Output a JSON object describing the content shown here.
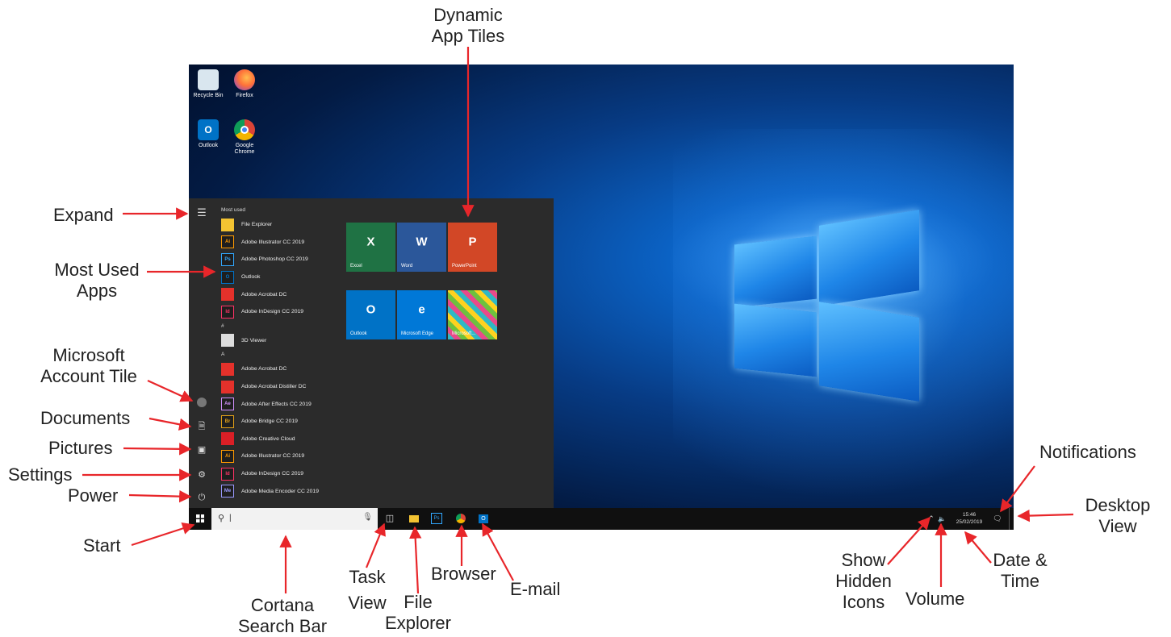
{
  "callouts": {
    "dynamic_tiles": [
      "Dynamic",
      "App Tiles"
    ],
    "expand": "Expand",
    "most_used_apps": [
      "Most Used",
      "Apps"
    ],
    "account_tile": [
      "Microsoft",
      "Account Tile"
    ],
    "documents": "Documents",
    "pictures": "Pictures",
    "settings": "Settings",
    "power": "Power",
    "start": "Start",
    "cortana": [
      "Cortana",
      "Search Bar"
    ],
    "task_view": [
      "Task",
      "View"
    ],
    "file_explorer": [
      "File",
      "Explorer"
    ],
    "browser": "Browser",
    "email": "E-mail",
    "notifications": "Notifications",
    "desktop_view": [
      "Desktop",
      "View"
    ],
    "show_hidden": [
      "Show",
      "Hidden",
      "Icons"
    ],
    "volume": "Volume",
    "date_time": [
      "Date &",
      "Time"
    ]
  },
  "desktop_icons": [
    {
      "label": "Recycle Bin",
      "icon": "recycle-bin-icon"
    },
    {
      "label": "Firefox",
      "icon": "firefox-icon"
    },
    {
      "label": "Outlook",
      "icon": "outlook-icon"
    },
    {
      "label": "Google Chrome",
      "icon": "chrome-icon"
    }
  ],
  "start_menu": {
    "most_used_header": "Most used",
    "most_used": [
      {
        "label": "File Explorer",
        "badge": "",
        "color": "#f3c332"
      },
      {
        "label": "Adobe Illustrator CC 2019",
        "badge": "Ai",
        "color": "#ff9a00"
      },
      {
        "label": "Adobe Photoshop CC 2019",
        "badge": "Ps",
        "color": "#31a8ff"
      },
      {
        "label": "Outlook",
        "badge": "O",
        "color": "#0072c6"
      },
      {
        "label": "Adobe Acrobat DC",
        "badge": "",
        "color": "#e4312b"
      },
      {
        "label": "Adobe InDesign CC 2019",
        "badge": "Id",
        "color": "#ff3366"
      }
    ],
    "section_hash": "#",
    "hash_apps": [
      {
        "label": "3D Viewer",
        "badge": "",
        "color": "#dddddd"
      }
    ],
    "section_a": "A",
    "a_apps": [
      {
        "label": "Adobe Acrobat DC",
        "badge": "",
        "color": "#e4312b"
      },
      {
        "label": "Adobe Acrobat Distiller DC",
        "badge": "",
        "color": "#e4312b"
      },
      {
        "label": "Adobe After Effects CC 2019",
        "badge": "Ae",
        "color": "#d291ff"
      },
      {
        "label": "Adobe Bridge CC 2019",
        "badge": "Br",
        "color": "#e2a017"
      },
      {
        "label": "Adobe Creative Cloud",
        "badge": "",
        "color": "#da1f26"
      },
      {
        "label": "Adobe Illustrator CC 2019",
        "badge": "Ai",
        "color": "#ff9a00"
      },
      {
        "label": "Adobe InDesign CC 2019",
        "badge": "Id",
        "color": "#ff3366"
      },
      {
        "label": "Adobe Media Encoder CC 2019",
        "badge": "Me",
        "color": "#9999ff"
      }
    ],
    "tiles": [
      {
        "label": "Excel",
        "color": "#1f7244",
        "glyph": "X"
      },
      {
        "label": "Word",
        "color": "#2b579a",
        "glyph": "W"
      },
      {
        "label": "PowerPoint",
        "color": "#d24726",
        "glyph": "P"
      },
      {
        "label": "Outlook",
        "color": "#0072c6",
        "glyph": "O"
      },
      {
        "label": "Microsoft Edge",
        "color": "#0078d7",
        "glyph": "e"
      },
      {
        "label": "Microsoft...",
        "color": "#19b3c6",
        "glyph": ""
      }
    ]
  },
  "taskbar": {
    "search_placeholder": "|",
    "clock_time": "15:46",
    "clock_date": "25/02/2019"
  }
}
